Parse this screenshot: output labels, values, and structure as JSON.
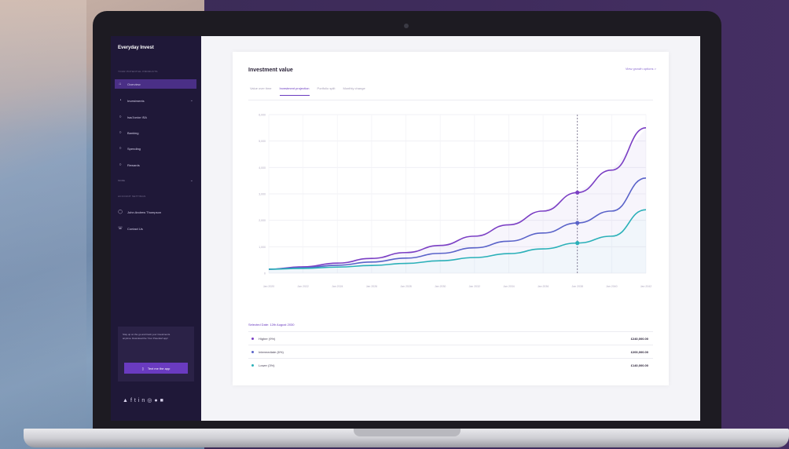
{
  "sidebar": {
    "logo": "Everyday Invest",
    "section_products": "YOUR POTENTIAL PRODUCTS",
    "items": [
      {
        "label": "Overview",
        "icon": "home-icon",
        "active": true
      },
      {
        "label": "Investments",
        "icon": "chart-icon"
      },
      {
        "label": "Isa/Junior ISA",
        "icon": "wallet-icon"
      },
      {
        "label": "Banking",
        "icon": "bank-icon"
      },
      {
        "label": "Spending",
        "icon": "card-icon"
      },
      {
        "label": "Rewards",
        "icon": "gift-icon"
      }
    ],
    "more_label": "MORE",
    "section_account": "ACCOUNT SETTINGS",
    "account_items": [
      {
        "label": "John Andrew Thompson",
        "icon": "user-icon"
      },
      {
        "label": "Contact Us",
        "icon": "phone-icon"
      }
    ],
    "promo_text": "Stay up on the go and track your investments anytime. Download the 'Your Potential' app!",
    "promo_button": "Text me the app"
  },
  "main": {
    "title": "Investment value",
    "link": "View growth options >",
    "tabs": [
      "Value over time",
      "Investment projection",
      "Portfolio split",
      "Monthly change"
    ],
    "active_tab": 1,
    "selected_date": "Selected Date: 12th August 2030",
    "rows": [
      {
        "label": "Higher (9%)",
        "value": "£240,000.00",
        "color": "#7b3fc4"
      },
      {
        "label": "Intermediate (6%)",
        "value": "£200,000.00",
        "color": "#5a63c9"
      },
      {
        "label": "Lower (3%)",
        "value": "£140,000.00",
        "color": "#2ab0b8"
      }
    ]
  },
  "chart_data": {
    "type": "line",
    "x": [
      "Jan 2020",
      "Jan 2022",
      "Jan 2024",
      "Jan 2026",
      "Jan 2028",
      "Jan 2030",
      "Jan 2032",
      "Jan 2034",
      "Jan 2036",
      "Jan 2038",
      "Jan 2040",
      "Jan 2042"
    ],
    "yticks": [
      "0",
      "1,000",
      "2,000",
      "3,000",
      "4,000",
      "5,000",
      "6,000"
    ],
    "ylim": [
      0,
      6000
    ],
    "series": [
      {
        "values": [
          150,
          240,
          380,
          560,
          780,
          1050,
          1400,
          1830,
          2350,
          3050,
          3900,
          5500
        ],
        "color": "#7b3fc4"
      },
      {
        "values": [
          150,
          210,
          300,
          420,
          570,
          750,
          960,
          1210,
          1520,
          1900,
          2350,
          3600
        ],
        "color": "#5a63c9"
      },
      {
        "values": [
          150,
          180,
          230,
          290,
          370,
          470,
          590,
          740,
          920,
          1140,
          1400,
          2400
        ],
        "color": "#2ab0b8"
      }
    ],
    "marker_x_index": 9,
    "grid": true
  }
}
